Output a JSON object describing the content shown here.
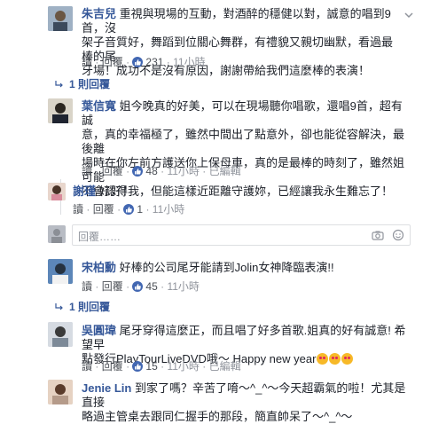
{
  "actions": {
    "read": "讀",
    "reply": "回覆",
    "dot": "·",
    "edited": "已編輯"
  },
  "comments": [
    {
      "name": "朱吉兒",
      "text_lines": [
        "重視與現場的互動，對酒醉的穩健以對，誠意的唱到9首，沒",
        "架子音質好，舞蹈到位關心舞群，有禮貌又親切幽默，看過最棒的尾",
        "牙場！成功不是沒有原因，謝謝帶給我們這麼棒的表演！"
      ],
      "likes": "231",
      "time": "11小時"
    },
    {
      "name": "葉信寬",
      "text_lines": [
        "姐今晚真的好美，可以在現場聽你唱歌，還唱9首，超有誠",
        "意，真的幸福極了，雖然中間出了點意外，卻也能從容解決，最後離",
        "場時在你左前方護送你上保母車，真的是最棒的時刻了，雖然姐可能",
        "不會認得我，但能這樣近距離守護妳，已經讓我永生難忘了！"
      ],
      "likes": "48",
      "time": "11小時"
    },
    {
      "name": "宋柏勳",
      "text_lines": [
        "好棒的公司尾牙能請到Jolin女神降臨表演!!"
      ],
      "likes": "45",
      "time": "11小時"
    },
    {
      "name": "吳圓瑋",
      "text_lines": [
        "尾牙穿得這麼正，而且唱了好多首歌.姐真的好有誠意! 希望早",
        "點發行PlayTourLiveDVD哦〜 Happy new year"
      ],
      "likes": "15",
      "time": "11小時"
    },
    {
      "name": "Jenie Lin",
      "text_lines": [
        "到家了嗎？辛苦了唷〜^_^〜今天超霸氣的啦！尤其是直接",
        "略過主管桌去跟同仁握手的那段，簡直帥呆了〜^_^〜"
      ]
    }
  ],
  "reply_link_1": "1 則回覆",
  "reply_link_2": "1 則回覆",
  "nested_reply": {
    "name": "謝瑾",
    "text": "好好！",
    "likes": "1",
    "time": "11小時"
  },
  "reply_placeholder": "回覆……",
  "colors": {
    "link": "#365899",
    "meta": "#90949c",
    "like": "#4267b2"
  }
}
